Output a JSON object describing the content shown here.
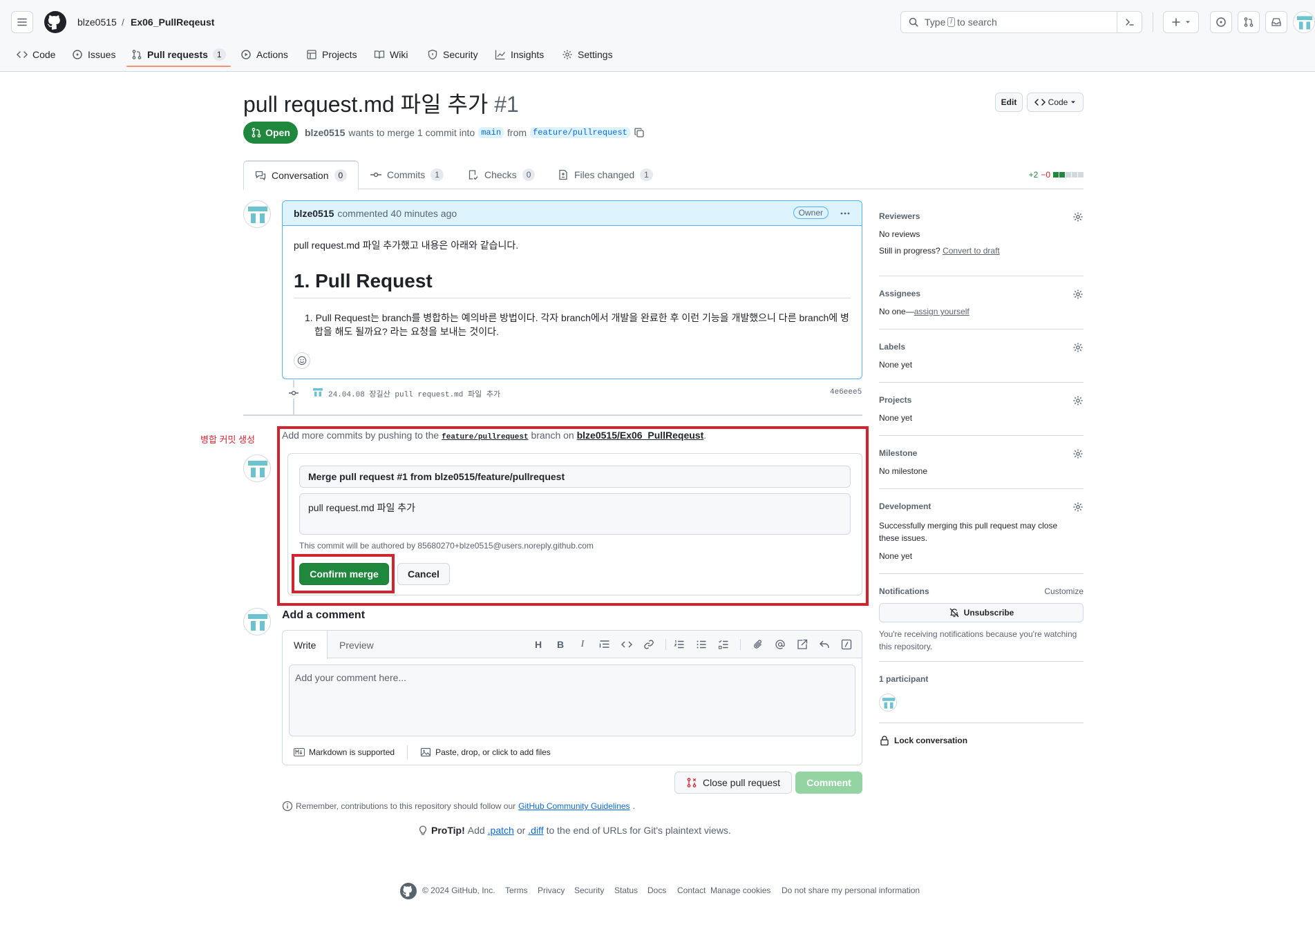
{
  "header": {
    "owner": "blze0515",
    "separator": "/",
    "repo": "Ex06_PullReqeust",
    "search_prefix": "Type",
    "search_key": "/",
    "search_suffix": "to search"
  },
  "repo_tabs": [
    {
      "label": "Code"
    },
    {
      "label": "Issues"
    },
    {
      "label": "Pull requests",
      "count": "1"
    },
    {
      "label": "Actions"
    },
    {
      "label": "Projects"
    },
    {
      "label": "Wiki"
    },
    {
      "label": "Security"
    },
    {
      "label": "Insights"
    },
    {
      "label": "Settings"
    }
  ],
  "pr": {
    "title": "pull request.md 파일 추가",
    "number": "#1",
    "edit_label": "Edit",
    "code_label": "Code",
    "state": "Open",
    "author": "blze0515",
    "merge_text": "wants to merge 1 commit into",
    "base": "main",
    "from_text": "from",
    "head": "feature/pullrequest"
  },
  "pr_tabs": [
    {
      "label": "Conversation",
      "count": "0"
    },
    {
      "label": "Commits",
      "count": "1"
    },
    {
      "label": "Checks",
      "count": "0"
    },
    {
      "label": "Files changed",
      "count": "1"
    }
  ],
  "diffstat": {
    "add": "+2",
    "del": "−0"
  },
  "comment": {
    "author": "blze0515",
    "time": "commented 40 minutes ago",
    "badge": "Owner",
    "intro": "pull request.md 파일 추가했고 내용은 아래와 같습니다.",
    "heading": "1. Pull Request",
    "item": "1. Pull Request는 branch를 병합하는 예의바른 방법이다. 각자 branch에서 개발을 완료한 후 이런 기능을 개발했으니 다른 branch에 병합을 해도 될까요? 라는 요청을 보내는 것이다."
  },
  "commit": {
    "message": "24.04.08 장길산 pull request.md 파일 추가",
    "sha": "4e6eee5"
  },
  "merge": {
    "annotation": "병합 커밋 생성",
    "hint_prefix": "Add more commits by pushing to the",
    "hint_branch": "feature/pullrequest",
    "hint_mid": "branch on",
    "hint_repo": "blze0515/Ex06_PullReqeust",
    "hint_end": ".",
    "commit_title": "Merge pull request #1 from blze0515/feature/pullrequest",
    "commit_body": "pull request.md 파일 추가",
    "author_note": "This commit will be authored by 85680270+blze0515@users.noreply.github.com",
    "confirm_label": "Confirm merge",
    "cancel_label": "Cancel"
  },
  "add_comment": {
    "heading": "Add a comment",
    "write_tab": "Write",
    "preview_tab": "Preview",
    "placeholder": "Add your comment here...",
    "markdown_note": "Markdown is supported",
    "attach_note": "Paste, drop, or click to add files",
    "close_label": "Close pull request",
    "comment_label": "Comment",
    "guidelines_prefix": "Remember, contributions to this repository should follow our",
    "guidelines_link": "GitHub Community Guidelines",
    "guidelines_end": ".",
    "protip_label": "ProTip!",
    "protip_1": "Add",
    "protip_patch": ".patch",
    "protip_or": "or",
    "protip_diff": ".diff",
    "protip_2": "to the end of URLs for Git's plaintext views."
  },
  "sidebar": {
    "reviewers": {
      "heading": "Reviewers",
      "value": "No reviews",
      "progress": "Still in progress?",
      "draft_link": "Convert to draft"
    },
    "assignees": {
      "heading": "Assignees",
      "value": "No one—",
      "link": "assign yourself"
    },
    "labels": {
      "heading": "Labels",
      "value": "None yet"
    },
    "projects": {
      "heading": "Projects",
      "value": "None yet"
    },
    "milestone": {
      "heading": "Milestone",
      "value": "No milestone"
    },
    "development": {
      "heading": "Development",
      "desc": "Successfully merging this pull request may close these issues.",
      "value": "None yet"
    },
    "notifications": {
      "heading": "Notifications",
      "customize": "Customize",
      "button": "Unsubscribe",
      "desc": "You're receiving notifications because you're watching this repository."
    },
    "participants": {
      "heading": "1 participant"
    },
    "lock": "Lock conversation"
  },
  "footer": {
    "copyright": "© 2024 GitHub, Inc.",
    "links": [
      "Terms",
      "Privacy",
      "Security",
      "Status",
      "Docs",
      "Contact",
      "Manage cookies",
      "Do not share my personal information"
    ]
  },
  "colors": {
    "accent": "#0969da",
    "success": "#1f883d",
    "danger": "#d1242f",
    "header_bg": "#f6f8fa"
  }
}
